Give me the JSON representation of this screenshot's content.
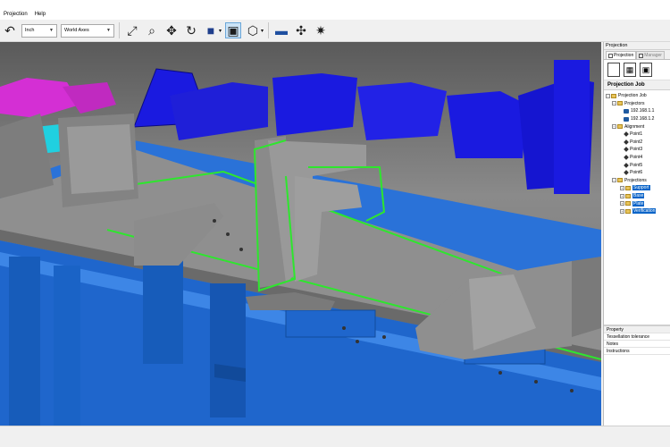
{
  "menubar": {
    "items": [
      "Projection",
      "Help"
    ]
  },
  "toolbar": {
    "undo_icon": "undo-arrow-icon",
    "unit_select": "Inch",
    "axes_select": "World Axes",
    "icons": [
      "zoom-fit-icon",
      "zoom-window-icon",
      "pan-icon",
      "rotate-icon",
      "cube-view-icon",
      "select-tool-icon",
      "box-view-icon",
      "projector-icon",
      "point-add-icon",
      "laser-icon"
    ]
  },
  "panel": {
    "title": "Projection",
    "tabs": [
      {
        "label": "Projection",
        "active": true
      },
      {
        "label": "Manager",
        "active": false
      }
    ],
    "tree_header": "Projection Job",
    "tree": {
      "root": "Projection Job",
      "projectors_label": "Projectors",
      "projectors": [
        "192.168.1.1",
        "192.168.1.2"
      ],
      "alignment_label": "Alignment",
      "points": [
        "Point1",
        "Point2",
        "Point3",
        "Point4",
        "Point5",
        "Point6"
      ],
      "projections_label": "Projections",
      "projections": [
        "Support",
        "Base",
        "Plate",
        "Verification"
      ]
    },
    "properties": {
      "header": "Property",
      "rows": [
        "Tessellation tolerance",
        "Notes",
        "Instructions"
      ]
    }
  },
  "colors": {
    "fixture_blue": "#2a72d8",
    "frame_blue": "#1f66cc",
    "deep_blue": "#1a1ae0",
    "magenta": "#d42fd4",
    "plate_gray": "#8f8f8f",
    "outline_green": "#2ee62e",
    "selection": "#0a64c8"
  }
}
